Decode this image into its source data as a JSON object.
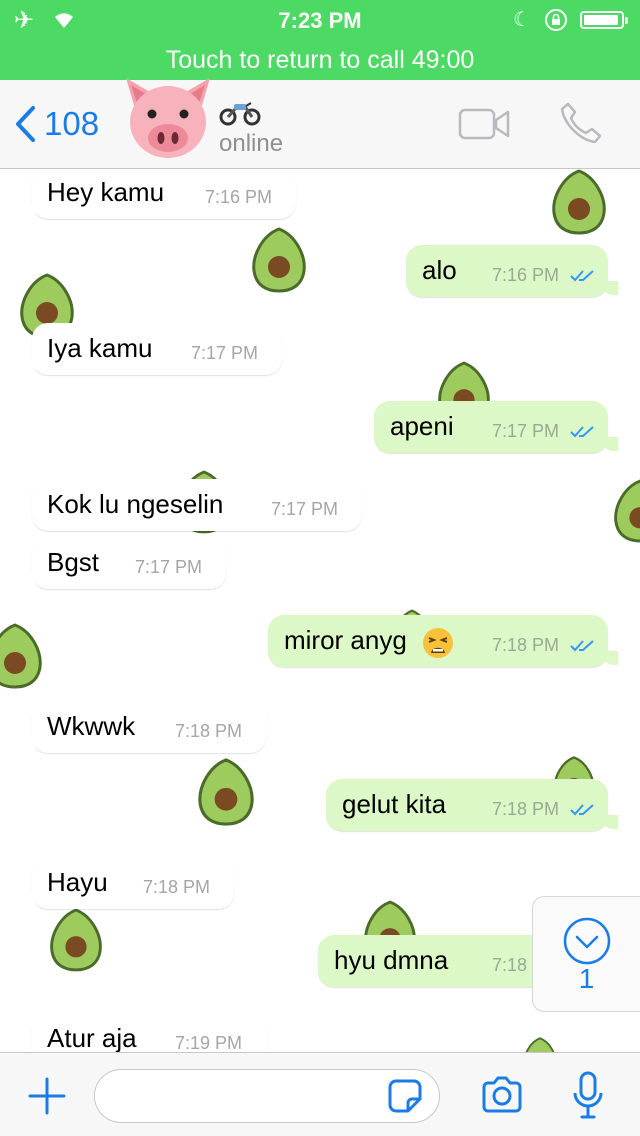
{
  "status_bar": {
    "time": "7:23 PM",
    "call_banner": "Touch to return to call 49:00",
    "battery_level": 0.9
  },
  "header": {
    "back_count": "108",
    "contact_avatar": "pig-face-emoji",
    "contact_name_emoji": "motorcycle-emoji",
    "presence": "online"
  },
  "messages": [
    {
      "text": "Hey kamu",
      "time": "7:16 PM",
      "direction": "incoming"
    },
    {
      "text": "alo",
      "time": "7:16 PM",
      "direction": "outgoing",
      "status": "read"
    },
    {
      "text": "Iya kamu",
      "time": "7:17 PM",
      "direction": "incoming"
    },
    {
      "text": "apeni",
      "time": "7:17 PM",
      "direction": "outgoing",
      "status": "read"
    },
    {
      "text": "Kok lu ngeselin",
      "time": "7:17 PM",
      "direction": "incoming"
    },
    {
      "text": "Bgst",
      "time": "7:17 PM",
      "direction": "incoming"
    },
    {
      "text": "miror anyg",
      "time": "7:18 PM",
      "direction": "outgoing",
      "status": "read",
      "emoji": "tired-face-emoji"
    },
    {
      "text": "Wkwwk",
      "time": "7:18 PM",
      "direction": "incoming"
    },
    {
      "text": "gelut kita",
      "time": "7:18 PM",
      "direction": "outgoing",
      "status": "read"
    },
    {
      "text": "Hayu",
      "time": "7:18 PM",
      "direction": "incoming"
    },
    {
      "text": "hyu dmna",
      "time": "7:18",
      "direction": "outgoing"
    },
    {
      "text": "Atur aja",
      "time": "7:19 PM",
      "direction": "incoming"
    }
  ],
  "scroll_button": {
    "count": "1"
  },
  "input_bar": {
    "placeholder": ""
  },
  "colors": {
    "status_green": "#4cd964",
    "accent_blue": "#1a7de6",
    "outgoing_bubble": "#dcf8c6",
    "incoming_bubble": "#ffffff"
  }
}
